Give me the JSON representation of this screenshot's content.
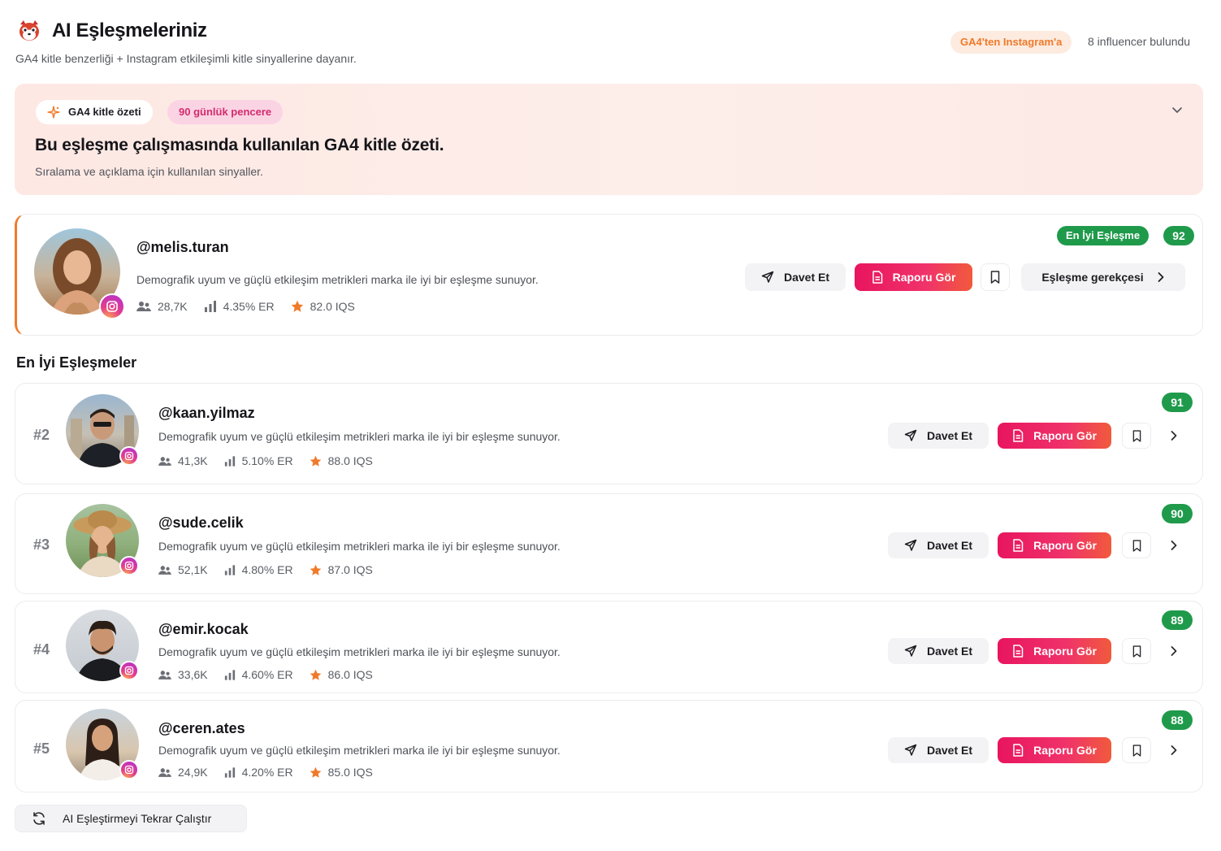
{
  "header": {
    "title": "AI Eşleşmeleriniz",
    "subtitle": "GA4 kitle benzerliği + Instagram etkileşimli kitle sinyallerine dayanır.",
    "source_badge": "GA4'ten Instagram'a",
    "found_text": "8 influencer bulundu"
  },
  "summary": {
    "chip_label": "GA4 kitle özeti",
    "window_label": "90 günlük pencere",
    "title": "Bu eşleşme çalışmasında kullanılan GA4 kitle özeti.",
    "description": "Sıralama ve açıklama için kullanılan sinyaller."
  },
  "featured": {
    "handle": "@melis.turan",
    "description": "Demografik uyum ve güçlü etkileşim metrikleri marka ile iyi bir eşleşme sunuyor.",
    "followers": "28,7K",
    "er": "4.35% ER",
    "iqs": "82.0 IQS",
    "best_label": "En İyi Eşleşme",
    "score": "92",
    "invite_label": "Davet Et",
    "report_label": "Raporu Gör",
    "reason_label": "Eşleşme gerekçesi"
  },
  "section_title": "En İyi Eşleşmeler",
  "matches": [
    {
      "rank": "#2",
      "handle": "@kaan.yilmaz",
      "description": "Demografik uyum ve güçlü etkileşim metrikleri marka ile iyi bir eşleşme sunuyor.",
      "followers": "41,3K",
      "er": "5.10% ER",
      "iqs": "88.0 IQS",
      "score": "91",
      "invite_label": "Davet Et",
      "report_label": "Raporu Gör"
    },
    {
      "rank": "#3",
      "handle": "@sude.celik",
      "description": "Demografik uyum ve güçlü etkileşim metrikleri marka ile iyi bir eşleşme sunuyor.",
      "followers": "52,1K",
      "er": "4.80% ER",
      "iqs": "87.0 IQS",
      "score": "90",
      "invite_label": "Davet Et",
      "report_label": "Raporu Gör"
    },
    {
      "rank": "#4",
      "handle": "@emir.kocak",
      "description": "Demografik uyum ve güçlü etkileşim metrikleri marka ile iyi bir eşleşme sunuyor.",
      "followers": "33,6K",
      "er": "4.60% ER",
      "iqs": "86.0 IQS",
      "score": "89",
      "invite_label": "Davet Et",
      "report_label": "Raporu Gör"
    },
    {
      "rank": "#5",
      "handle": "@ceren.ates",
      "description": "Demografik uyum ve güçlü etkileşim metrikleri marka ile iyi bir eşleşme sunuyor.",
      "followers": "24,9K",
      "er": "4.20% ER",
      "iqs": "85.0 IQS",
      "score": "88",
      "invite_label": "Davet Et",
      "report_label": "Raporu Gör"
    }
  ],
  "rerun_label": "AI Eşleştirmeyi Tekrar Çalıştır",
  "colors": {
    "accent_orange": "#f07a2a",
    "accent_pink": "#e8155f",
    "score_green": "#1f9a4b",
    "summary_bg": "#fdeeea"
  },
  "icons": [
    "red-panda-logo-icon",
    "sparkle-icon",
    "chevron-down-icon",
    "instagram-icon",
    "users-icon",
    "bar-chart-icon",
    "star-icon",
    "send-icon",
    "document-icon",
    "bookmark-icon",
    "chevron-right-icon",
    "refresh-icon"
  ]
}
